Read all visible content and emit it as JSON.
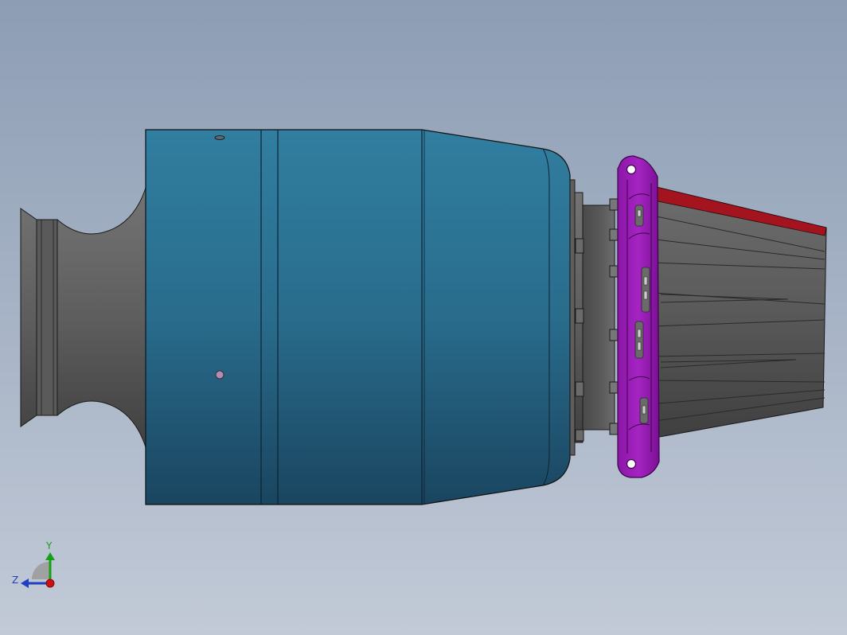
{
  "viewport": {
    "background_top": "#8d9db4",
    "background_bottom": "#c2cad7"
  },
  "model": {
    "casing_color": "#2c6f8f",
    "metal_color": "#6b6b6b",
    "flange_color": "#9b1fb6",
    "vane_accent_color": "#b01020",
    "outline_color": "#1a1a1a"
  },
  "triad": {
    "y_label": "Y",
    "z_label": "Z",
    "y_color": "#16a016",
    "z_color": "#2040c0",
    "x_color": "#d01010",
    "icon": "coordinate-triad-icon"
  }
}
